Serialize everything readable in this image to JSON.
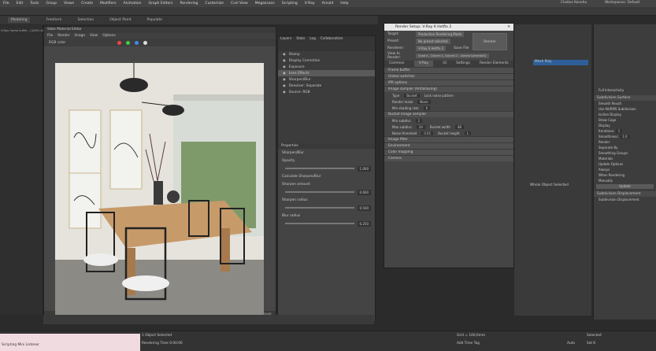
{
  "menu": [
    "File",
    "Edit",
    "Tools",
    "Group",
    "Views",
    "Create",
    "Modifiers",
    "Animation",
    "Graph Editors",
    "Rendering",
    "Customize",
    "Civil View",
    "Megascans",
    "Scripting",
    "V-Ray",
    "Arnold",
    "Help"
  ],
  "user": "Clodius Konoha",
  "workspaces": "Workspaces: Default",
  "ribbon": [
    "Modeling",
    "Freeform",
    "Selection",
    "Object Paint",
    "Populate"
  ],
  "sfe": {
    "title": "Slate Material Editor",
    "menu": [
      "File",
      "Render",
      "Image",
      "View",
      "Options"
    ],
    "subtitle": "RGB color",
    "bottom_status": "Rendering image (pass 26) 00:00:00 [00:00:00 est]"
  },
  "viewport_label": "V-Ray frame buffer - [100% of 1350 x 900]",
  "layers": {
    "tabs": [
      "Layers",
      "Stats",
      "Log",
      "Collaboration"
    ],
    "rows": [
      "Stamp",
      "Display Correction",
      "Exposure",
      "Lens Effects",
      "Sharpen/Blur",
      "Denoiser: Separate",
      "Source: RGB"
    ],
    "selected": 3
  },
  "properties": {
    "header": "Properties",
    "section": "Sharpen/Blur",
    "opacity": "Opacity",
    "opacity_val": "1.000",
    "calc": "Calculate Sharpen/Blur",
    "sharpen_amount": "Sharpen amount",
    "sharpen_amount_val": "0.600",
    "sharpen_radius": "Sharpen radius",
    "sharpen_radius_val": "0.500",
    "blur_radius": "Blur radius",
    "blur_radius_val": "0.250"
  },
  "render_setup": {
    "title": "Render Setup: V-Ray 6 Hotfix 2",
    "target_lbl": "Target:",
    "target": "Production Rendering Mode",
    "preset_lbl": "Preset:",
    "preset": "No preset selected",
    "renderer_lbl": "Renderer:",
    "renderer": "V-Ray 6 Hotfix 2",
    "save_file": "Save File",
    "view_lbl": "View to Render:",
    "view": "Quad 4 - Column 1, Column 2 - Corona Camera001",
    "render_btn": "Render",
    "tabs": [
      "Common",
      "V-Ray",
      "GI",
      "Settings",
      "Render Elements"
    ],
    "active_tab": "V-Ray",
    "rollouts": [
      "Frame buffer",
      "Global switches",
      "IPR options",
      "Image sampler (Antialiasing)"
    ],
    "type_lbl": "Type",
    "type_val": "Bucket",
    "lock_noise": "Lock noise pattern",
    "render_mask": "Render mask",
    "render_mask_val": "None",
    "min_shading_lbl": "Min shading rate",
    "min_shading_val": "6",
    "bucket_sampler": "Bucket image sampler",
    "min_subdivs": "Min subdivs",
    "min_subdivs_val": "1",
    "max_subdivs": "Max subdivs",
    "max_subdivs_val": "24",
    "noise": "Noise threshold",
    "noise_val": "0.01",
    "bucket_width": "Bucket width",
    "bucket_width_val": "48",
    "bucket_height": "Bucket height",
    "bucket_height_val": "L",
    "rollouts2": [
      "Image filter",
      "Environment",
      "Color mapping",
      "Camera"
    ]
  },
  "right": {
    "list_item": "Mesh Poly",
    "section": "Subdivision Surface",
    "items": [
      "Smooth Result",
      "Use NURMS Subdivision",
      "Isoline Display",
      "Show Cage"
    ],
    "display": "Display",
    "iterations": "Iterations:",
    "iterations_val": "1",
    "smoothness": "Smoothness:",
    "smoothness_val": "1.0",
    "render": "Render",
    "separate": "Separate By",
    "smoothing_groups": "Smoothing Groups",
    "materials": "Materials",
    "update": "Update Options",
    "always": "Always",
    "when_rendering": "When Rendering",
    "manually": "Manually",
    "update_btn": "Update",
    "sub_disp": "Subdivision Displacement",
    "sub_disp_chk": "Subdivision Displacement",
    "full_interactivity": "Full Interactivity",
    "whole_object": "Whole Object Selected"
  },
  "status": {
    "listener": "Scripting Mini Listener",
    "selected": "1 Object Selected",
    "render_time": "Rendering Time 0:00:06",
    "grid": "Grid = 100,0mm",
    "add_time_tag": "Add Time Tag",
    "selected_label": "Selected",
    "set_key": "Set K",
    "auto_key": "Auto"
  },
  "colors": {
    "accent": "#4a90d9"
  }
}
